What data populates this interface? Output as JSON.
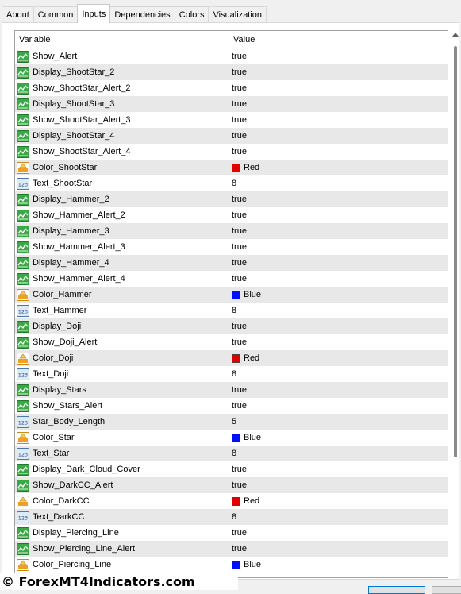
{
  "tabs": [
    {
      "label": "About",
      "active": false
    },
    {
      "label": "Common",
      "active": false
    },
    {
      "label": "Inputs",
      "active": true
    },
    {
      "label": "Dependencies",
      "active": false
    },
    {
      "label": "Colors",
      "active": false
    },
    {
      "label": "Visualization",
      "active": false
    }
  ],
  "columns": {
    "variable": "Variable",
    "value": "Value"
  },
  "colors": {
    "Red": "#e00000",
    "Blue": "#0010ff"
  },
  "rows": [
    {
      "icon": "bool-icon",
      "name": "Show_Alert",
      "value": "true"
    },
    {
      "icon": "bool-icon",
      "name": "Display_ShootStar_2",
      "value": "true"
    },
    {
      "icon": "bool-icon",
      "name": "Show_ShootStar_Alert_2",
      "value": "true"
    },
    {
      "icon": "bool-icon",
      "name": "Display_ShootStar_3",
      "value": "true"
    },
    {
      "icon": "bool-icon",
      "name": "Show_ShootStar_Alert_3",
      "value": "true"
    },
    {
      "icon": "bool-icon",
      "name": "Display_ShootStar_4",
      "value": "true"
    },
    {
      "icon": "bool-icon",
      "name": "Show_ShootStar_Alert_4",
      "value": "true"
    },
    {
      "icon": "color-icon",
      "name": "Color_ShootStar",
      "value": "Red",
      "color": "#e00000"
    },
    {
      "icon": "int-icon",
      "name": "Text_ShootStar",
      "value": "8"
    },
    {
      "icon": "bool-icon",
      "name": "Display_Hammer_2",
      "value": "true"
    },
    {
      "icon": "bool-icon",
      "name": "Show_Hammer_Alert_2",
      "value": "true"
    },
    {
      "icon": "bool-icon",
      "name": "Display_Hammer_3",
      "value": "true"
    },
    {
      "icon": "bool-icon",
      "name": "Show_Hammer_Alert_3",
      "value": "true"
    },
    {
      "icon": "bool-icon",
      "name": "Display_Hammer_4",
      "value": "true"
    },
    {
      "icon": "bool-icon",
      "name": "Show_Hammer_Alert_4",
      "value": "true"
    },
    {
      "icon": "color-icon",
      "name": "Color_Hammer",
      "value": "Blue",
      "color": "#0010ff"
    },
    {
      "icon": "int-icon",
      "name": "Text_Hammer",
      "value": "8"
    },
    {
      "icon": "bool-icon",
      "name": "Display_Doji",
      "value": "true"
    },
    {
      "icon": "bool-icon",
      "name": "Show_Doji_Alert",
      "value": "true"
    },
    {
      "icon": "color-icon",
      "name": "Color_Doji",
      "value": "Red",
      "color": "#e00000"
    },
    {
      "icon": "int-icon",
      "name": "Text_Doji",
      "value": "8"
    },
    {
      "icon": "bool-icon",
      "name": "Display_Stars",
      "value": "true"
    },
    {
      "icon": "bool-icon",
      "name": "Show_Stars_Alert",
      "value": "true"
    },
    {
      "icon": "int-icon",
      "name": "Star_Body_Length",
      "value": "5"
    },
    {
      "icon": "color-icon",
      "name": "Color_Star",
      "value": "Blue",
      "color": "#0010ff"
    },
    {
      "icon": "int-icon",
      "name": "Text_Star",
      "value": "8"
    },
    {
      "icon": "bool-icon",
      "name": "Display_Dark_Cloud_Cover",
      "value": "true"
    },
    {
      "icon": "bool-icon",
      "name": "Show_DarkCC_Alert",
      "value": "true"
    },
    {
      "icon": "color-icon",
      "name": "Color_DarkCC",
      "value": "Red",
      "color": "#e00000"
    },
    {
      "icon": "int-icon",
      "name": "Text_DarkCC",
      "value": "8"
    },
    {
      "icon": "bool-icon",
      "name": "Display_Piercing_Line",
      "value": "true"
    },
    {
      "icon": "bool-icon",
      "name": "Show_Piercing_Line_Alert",
      "value": "true"
    },
    {
      "icon": "color-icon",
      "name": "Color_Piercing_Line",
      "value": "Blue",
      "color": "#0010ff"
    }
  ],
  "watermark": "© ForexMT4Indicators.com"
}
